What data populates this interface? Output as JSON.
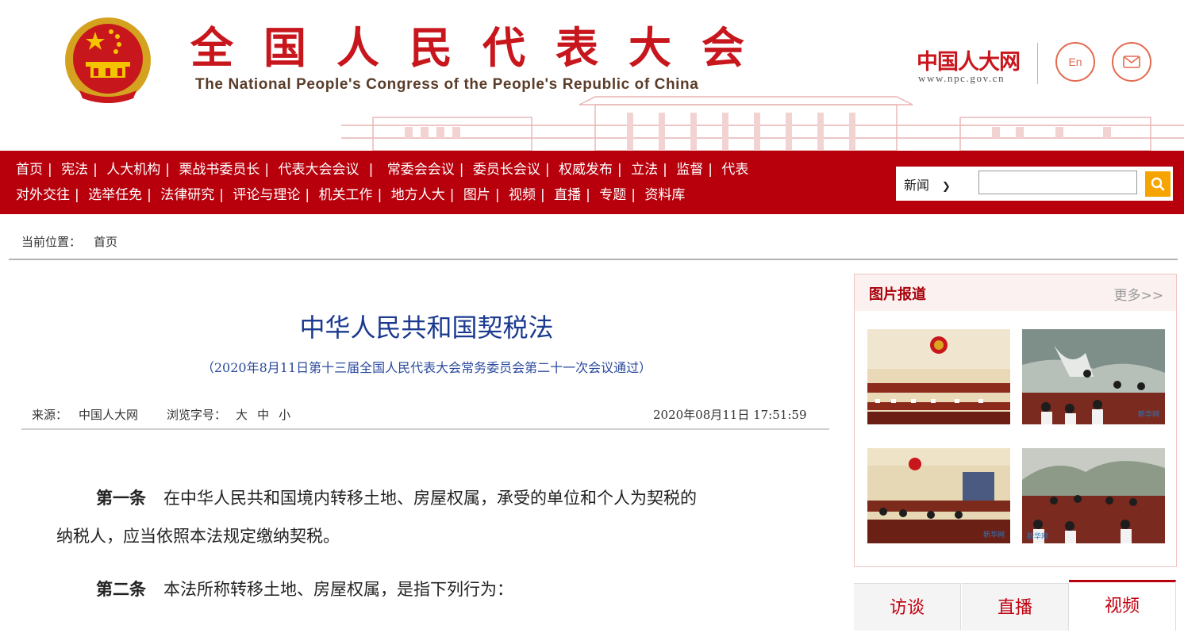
{
  "header": {
    "title_cn": "全国人民代表大会",
    "title_en": "The National People's Congress of the People's Republic of China",
    "site_logo": "中国人大网",
    "site_url": "www.npc.gov.cn",
    "lang_button": "En",
    "mail_icon": "mail-icon"
  },
  "nav": {
    "row1": [
      "首页",
      "宪法",
      "人大机构",
      "栗战书委员长",
      "代表大会会议",
      "常委会会议",
      "委员长会议",
      "权威发布",
      "立法",
      "监督",
      "代表"
    ],
    "row2": [
      "对外交往",
      "选举任免",
      "法律研究",
      "评论与理论",
      "机关工作",
      "地方人大",
      "图片",
      "视频",
      "直播",
      "专题",
      "资料库"
    ],
    "search": {
      "selected_option": "新闻",
      "input_value": "",
      "button_icon": "search-icon"
    }
  },
  "breadcrumb": {
    "label": "当前位置：",
    "current": "首页"
  },
  "article": {
    "title": "中华人民共和国契税法",
    "subtitle": "（2020年8月11日第十三届全国人民代表大会常务委员会第二十一次会议通过）",
    "source_label": "来源：",
    "source_value": "中国人大网",
    "font_label": "浏览字号：",
    "font_sizes": [
      "大",
      "中",
      "小"
    ],
    "datetime": "2020年08月11日  17:51:59",
    "paragraphs": [
      {
        "heading": "第一条",
        "line1": "在中华人民共和国境内转移土地、房屋权属，承受的单位和个人为契税的",
        "line2": "纳税人，应当依照本法规定缴纳契税。"
      },
      {
        "heading": "第二条",
        "line1": "本法所称转移土地、房屋权属，是指下列行为："
      }
    ]
  },
  "sidebar": {
    "photos": {
      "title": "图片报道",
      "more": "更多>>"
    },
    "tabs": [
      "访谈",
      "直播",
      "视频"
    ]
  },
  "colors": {
    "brand_red": "#b8000c",
    "title_red": "#c8161d",
    "title_blue": "#1a3a8f",
    "search_button": "#f5a400"
  }
}
